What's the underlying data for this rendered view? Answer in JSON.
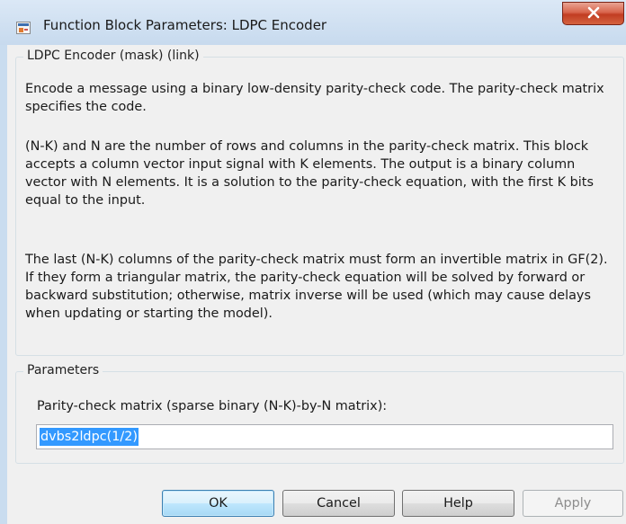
{
  "window": {
    "title": "Function Block Parameters: LDPC Encoder",
    "close_label": "X"
  },
  "description": {
    "group_label": "LDPC Encoder (mask) (link)",
    "paragraph1": "Encode a message using a binary low-density parity-check code. The parity-check matrix specifies the code.",
    "paragraph2": "(N-K) and N are the number of rows and columns in the parity-check matrix. This block accepts a column vector input signal with K elements. The output is a binary column vector with N elements. It is a solution to the parity-check equation, with the first K bits equal to the input.",
    "paragraph3": "The last (N-K) columns of the parity-check matrix must form an invertible matrix in GF(2). If they form a triangular matrix, the parity-check equation will be solved by forward or backward substitution; otherwise, matrix inverse will be used (which may cause delays when updating or starting the model)."
  },
  "parameters": {
    "group_label": "Parameters",
    "matrix_label": "Parity-check matrix (sparse binary (N-K)-by-N matrix):",
    "matrix_value": "dvbs2ldpc(1/2)"
  },
  "buttons": {
    "ok": "OK",
    "cancel": "Cancel",
    "help": "Help",
    "apply": "Apply"
  }
}
